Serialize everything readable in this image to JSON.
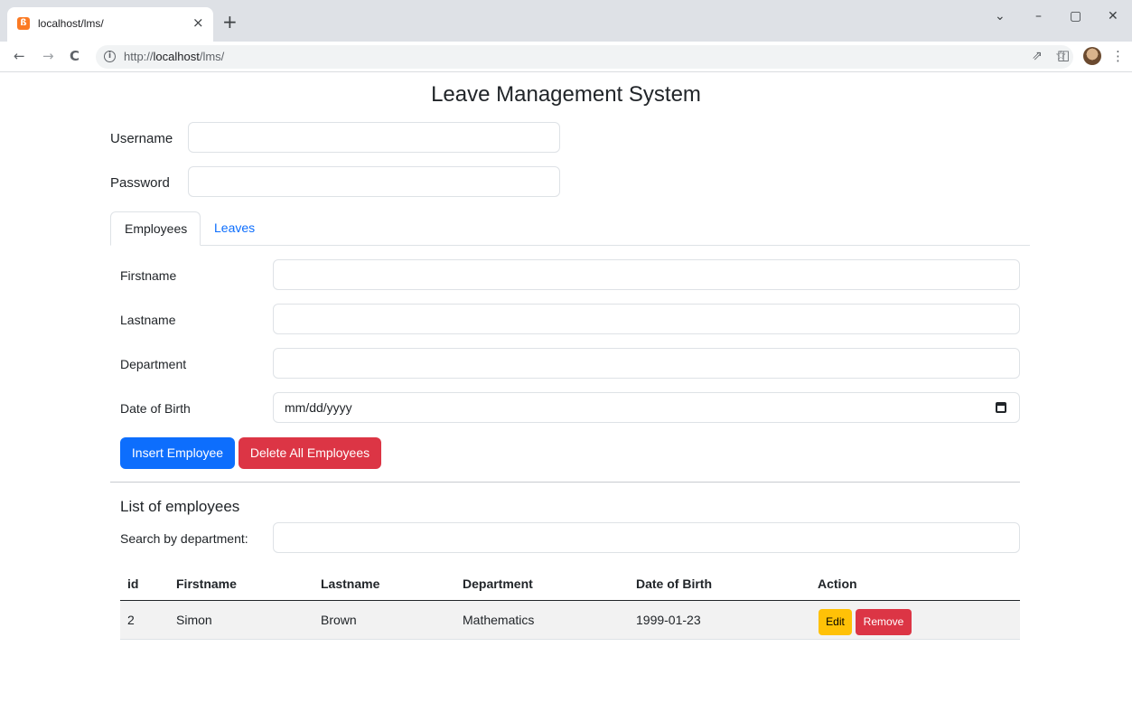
{
  "browser": {
    "tab_title": "localhost/lms/",
    "tab_close": "×",
    "new_tab": "+",
    "url_prefix": "http://",
    "url_host": "localhost",
    "url_path": "/lms/",
    "back_icon": "←",
    "forward_icon": "→",
    "reload_icon": "C",
    "share_icon": "⇗",
    "bookmark_icon": "☆",
    "sidepanel_icon": "◫",
    "menu_icon": "⋮",
    "minimize_icon": "–",
    "maximize_icon": "▢",
    "close_icon": "✕",
    "tabsearch_icon": "⌄"
  },
  "page": {
    "title": "Leave Management System"
  },
  "login": {
    "username_label": "Username",
    "username_value": "",
    "password_label": "Password",
    "password_value": ""
  },
  "tabs": [
    {
      "label": "Employees",
      "active": true
    },
    {
      "label": "Leaves",
      "active": false
    }
  ],
  "employee_form": {
    "firstname_label": "Firstname",
    "firstname_value": "",
    "lastname_label": "Lastname",
    "lastname_value": "",
    "department_label": "Department",
    "department_value": "",
    "dob_label": "Date of Birth",
    "dob_placeholder": "mm/dd/yyyy",
    "insert_button": "Insert Employee",
    "delete_all_button": "Delete All Employees"
  },
  "employee_list": {
    "title": "List of employees",
    "search_label": "Search by department:",
    "search_value": "",
    "columns": [
      "id",
      "Firstname",
      "Lastname",
      "Department",
      "Date of Birth",
      "Action"
    ],
    "rows": [
      {
        "id": "2",
        "firstname": "Simon",
        "lastname": "Brown",
        "department": "Mathematics",
        "dob": "1999-01-23",
        "edit_label": "Edit",
        "remove_label": "Remove"
      }
    ]
  },
  "colors": {
    "primary": "#0d6efd",
    "danger": "#dc3545",
    "warning": "#ffc107",
    "link": "#0d6efd"
  }
}
